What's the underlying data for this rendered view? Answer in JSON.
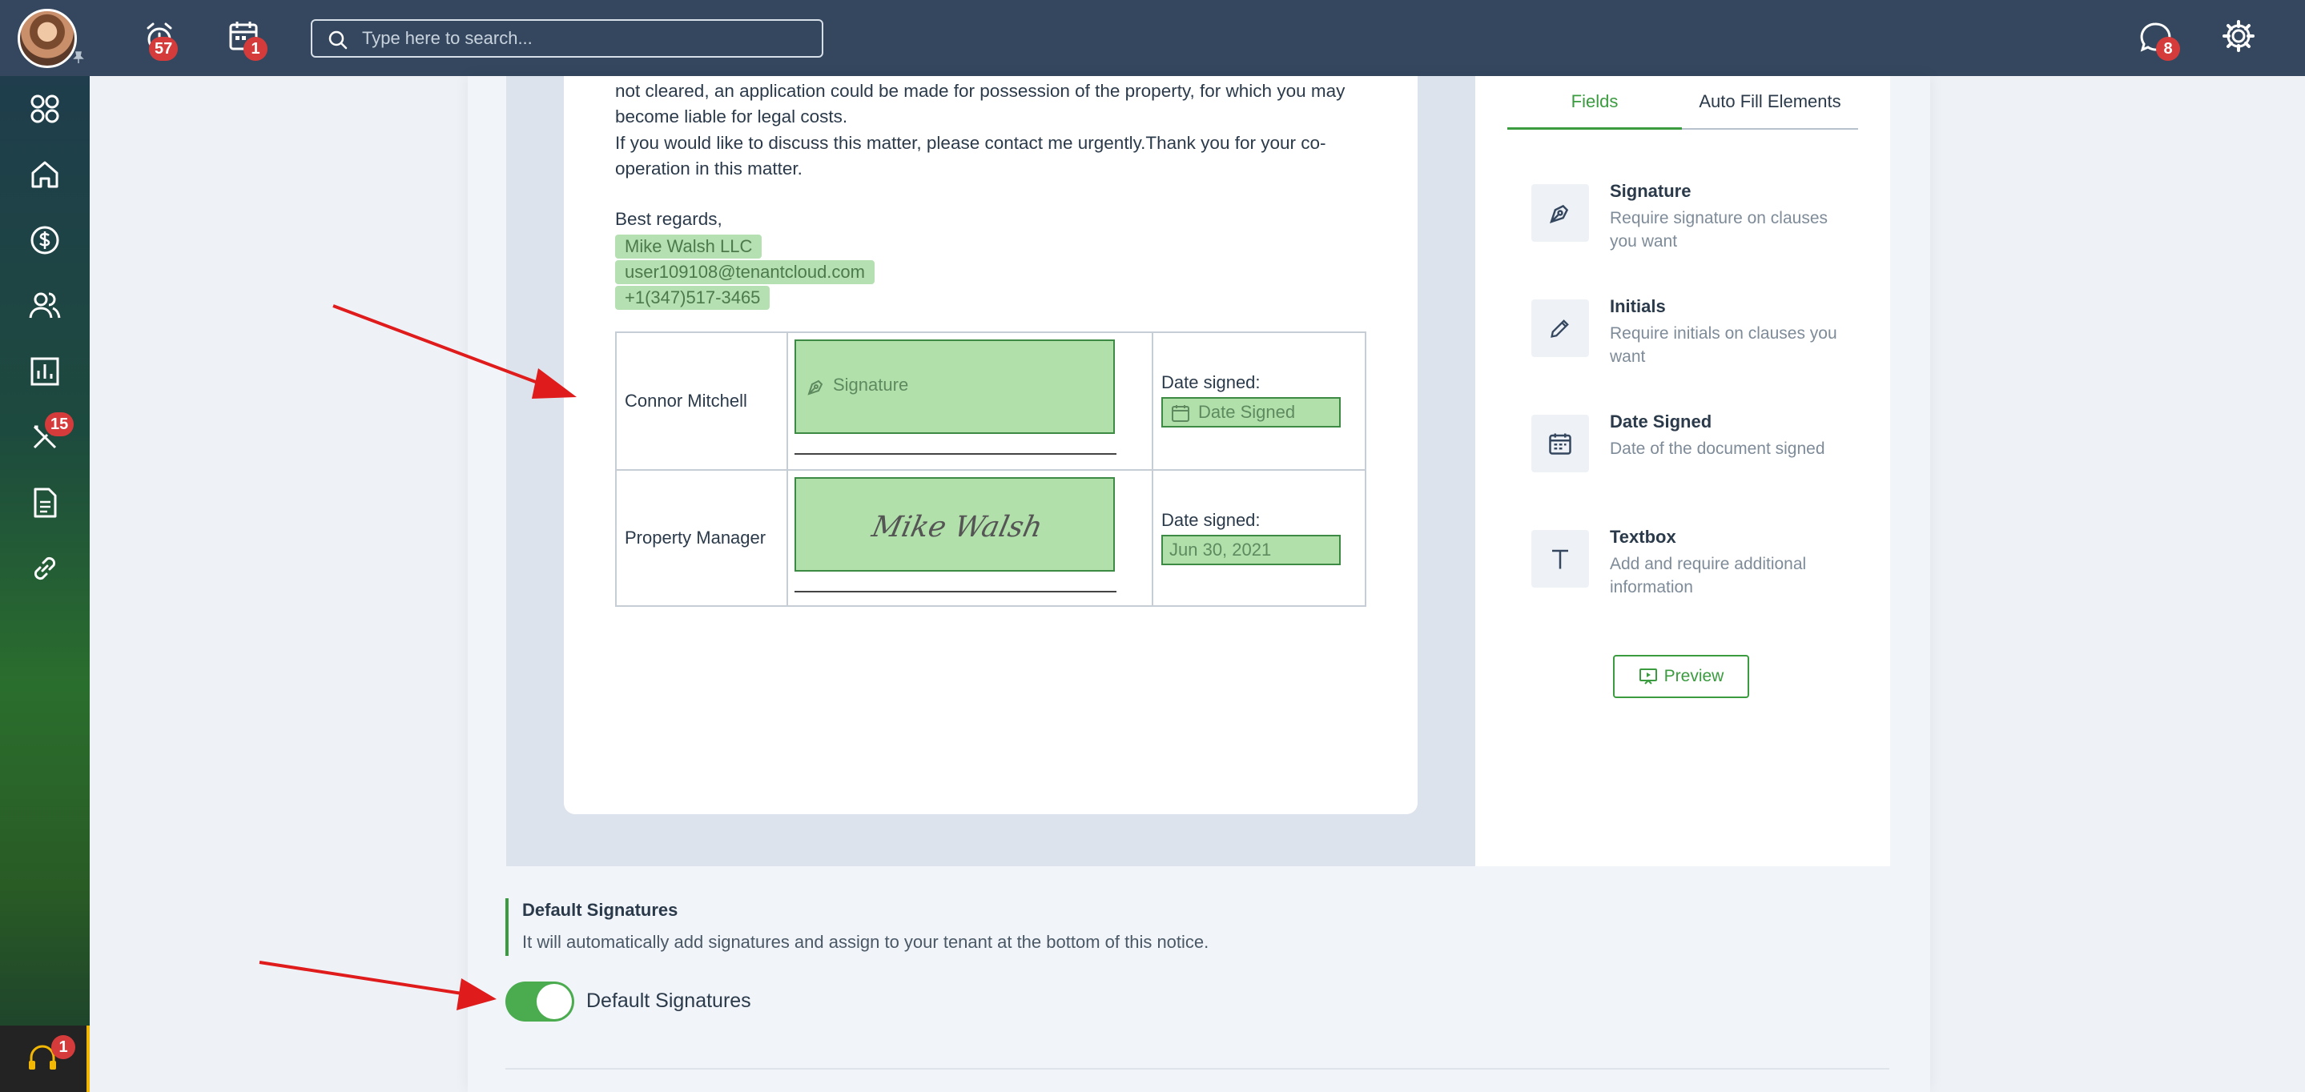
{
  "topbar": {
    "alerts_badge": "57",
    "calendar_badge": "1",
    "search_placeholder": "Type here to search...",
    "messages_badge": "8"
  },
  "sidebar": {
    "maintenance_badge": "15",
    "help_badge": "1"
  },
  "letter": {
    "lines": [
      "not cleared, an application could be made for possession of the property, for which you may",
      "become liable for legal costs.",
      "If you would like to discuss this matter, please contact me urgently.Thank you for your co-",
      "operation in this matter."
    ],
    "closing": "Best regards,",
    "company_tag": "Mike Walsh LLC",
    "email_tag": "user109108@tenantcloud.com",
    "phone_tag": "+1(347)517-3465"
  },
  "signature_table": {
    "rows": [
      {
        "name": "Connor Mitchell",
        "signature": "Signature",
        "date_label": "Date signed:",
        "date_value": "Date Signed"
      },
      {
        "name": "Property Manager",
        "signature": "Mike Walsh",
        "date_label": "Date signed:",
        "date_value": "Jun 30, 2021"
      }
    ]
  },
  "panel": {
    "tabs": [
      "Fields",
      "Auto Fill Elements"
    ],
    "active_tab": "Fields",
    "fields": [
      {
        "title": "Signature",
        "desc": "Require signature on clauses you want",
        "icon": "pen-nib-icon"
      },
      {
        "title": "Initials",
        "desc": "Require initials on clauses you want",
        "icon": "pencil-icon"
      },
      {
        "title": "Date Signed",
        "desc": "Date of the document signed",
        "icon": "calendar-icon"
      },
      {
        "title": "Textbox",
        "desc": "Add and require additional information",
        "icon": "text-t-icon"
      }
    ],
    "preview_label": "Preview"
  },
  "default_signatures": {
    "title": "Default Signatures",
    "description": "It will automatically add signatures and assign to your tenant at the bottom of this notice.",
    "toggle_label": "Default Signatures",
    "toggle_on": true
  },
  "colors": {
    "topbar": "#34475e",
    "accent_green": "#3a9b3f",
    "field_fill": "#b1e0ab",
    "badge_red": "#d63b3b",
    "annotation_arrow": "#e01b1b"
  }
}
